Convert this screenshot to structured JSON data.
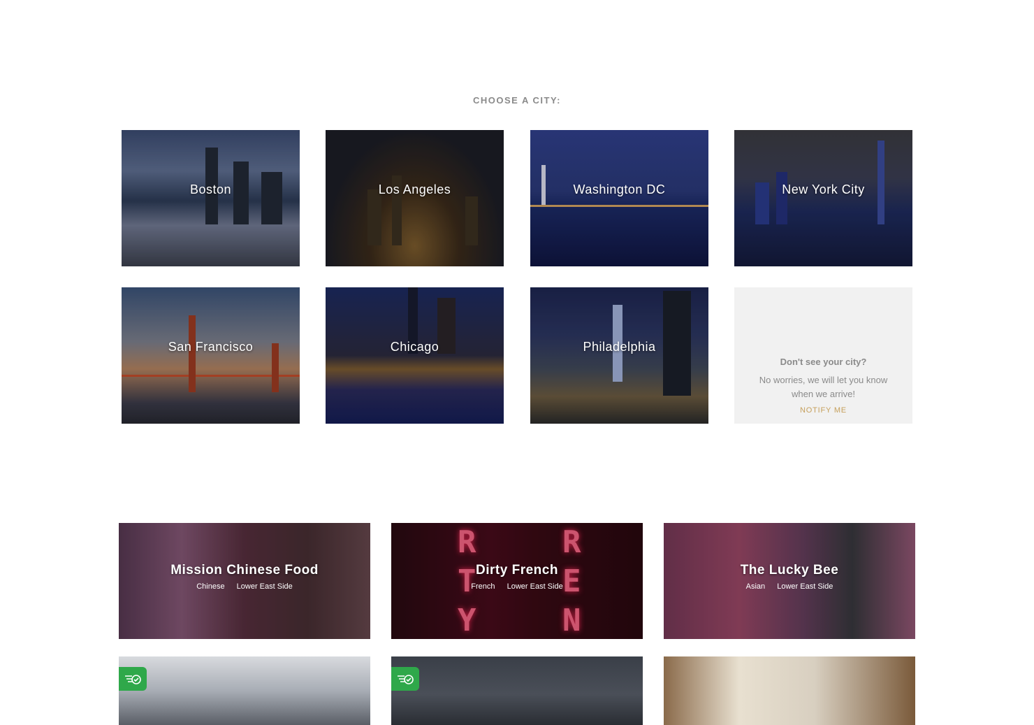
{
  "heading": "CHOOSE A CITY:",
  "cities": [
    {
      "name": "Boston"
    },
    {
      "name": "Los Angeles"
    },
    {
      "name": "Washington DC"
    },
    {
      "name": "New York City"
    },
    {
      "name": "San Francisco"
    },
    {
      "name": "Chicago"
    },
    {
      "name": "Philadelphia"
    }
  ],
  "notify": {
    "title": "Don't see your city?",
    "text": "No worries, we will let you know when we arrive!",
    "link": "NOTIFY ME"
  },
  "restaurants": [
    {
      "name": "Mission Chinese Food",
      "cuisine": "Chinese",
      "neighborhood": "Lower East Side"
    },
    {
      "name": "Dirty French",
      "cuisine": "French",
      "neighborhood": "Lower East Side"
    },
    {
      "name": "The Lucky Bee",
      "cuisine": "Asian",
      "neighborhood": "Lower East Side"
    }
  ],
  "neon": {
    "left": "RTY",
    "right": "RENCH"
  },
  "delivery_badge_icon": "delivery-icon",
  "colors": {
    "accent": "#c6a05c",
    "badge": "#2fa84a",
    "muted_text": "#8a8a8a"
  }
}
